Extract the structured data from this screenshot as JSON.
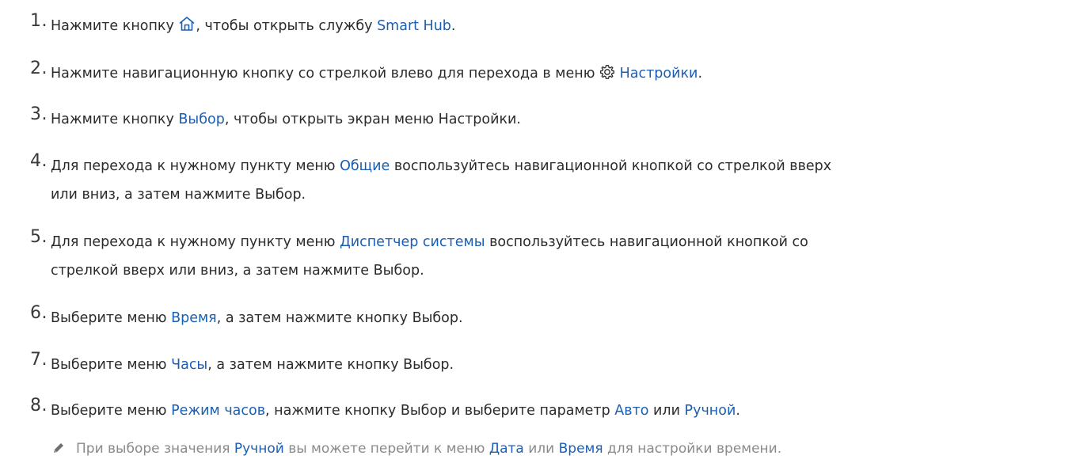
{
  "steps": [
    {
      "number": "1.",
      "lines": [
        [
          {
            "text": "Нажмите кнопку "
          },
          {
            "icon": "home-icon"
          },
          {
            "text": ", чтобы открыть службу "
          },
          {
            "text": "Smart Hub",
            "link": true
          },
          {
            "text": "."
          }
        ]
      ]
    },
    {
      "number": "2.",
      "lines": [
        [
          {
            "text": "Нажмите навигационную кнопку со стрелкой влево для перехода в меню "
          },
          {
            "icon": "gear-icon"
          },
          {
            "text": " "
          },
          {
            "text": "Настройки",
            "link": true
          },
          {
            "text": "."
          }
        ]
      ]
    },
    {
      "number": "3.",
      "lines": [
        [
          {
            "text": "Нажмите кнопку "
          },
          {
            "text": "Выбор",
            "link": true
          },
          {
            "text": ", чтобы открыть экран меню Настройки."
          }
        ]
      ]
    },
    {
      "number": "4.",
      "lines": [
        [
          {
            "text": "Для перехода к нужному пункту меню "
          },
          {
            "text": "Общие",
            "link": true
          },
          {
            "text": " воспользуйтесь навигационной кнопкой со стрелкой вверх"
          }
        ],
        [
          {
            "text": "или вниз, а затем нажмите Выбор."
          }
        ]
      ]
    },
    {
      "number": "5.",
      "lines": [
        [
          {
            "text": "Для перехода к нужному пункту меню "
          },
          {
            "text": "Диспетчер системы",
            "link": true
          },
          {
            "text": " воспользуйтесь навигационной кнопкой со"
          }
        ],
        [
          {
            "text": "стрелкой вверх или вниз, а затем нажмите Выбор."
          }
        ]
      ]
    },
    {
      "number": "6.",
      "lines": [
        [
          {
            "text": "Выберите меню "
          },
          {
            "text": "Время",
            "link": true
          },
          {
            "text": ", а затем нажмите кнопку Выбор."
          }
        ]
      ]
    },
    {
      "number": "7.",
      "lines": [
        [
          {
            "text": "Выберите меню "
          },
          {
            "text": "Часы",
            "link": true
          },
          {
            "text": ", а затем нажмите кнопку Выбор."
          }
        ]
      ]
    },
    {
      "number": "8.",
      "lines": [
        [
          {
            "text": "Выберите меню "
          },
          {
            "text": "Режим часов",
            "link": true
          },
          {
            "text": ", нажмите кнопку Выбор и выберите параметр "
          },
          {
            "text": "Авто",
            "link": true
          },
          {
            "text": " или "
          },
          {
            "text": "Ручной",
            "link": true
          },
          {
            "text": "."
          }
        ]
      ]
    }
  ],
  "note": {
    "icon": "pencil-icon",
    "parts": [
      {
        "text": "При выборе значения "
      },
      {
        "text": "Ручной",
        "link": true
      },
      {
        "text": " вы можете перейти к меню "
      },
      {
        "text": "Дата",
        "link": true
      },
      {
        "text": " или "
      },
      {
        "text": "Время",
        "link": true
      },
      {
        "text": " для настройки времени."
      }
    ]
  },
  "colors": {
    "text": "#2b2b2b",
    "link": "#1a5fb4",
    "note": "#8a8a8a"
  }
}
